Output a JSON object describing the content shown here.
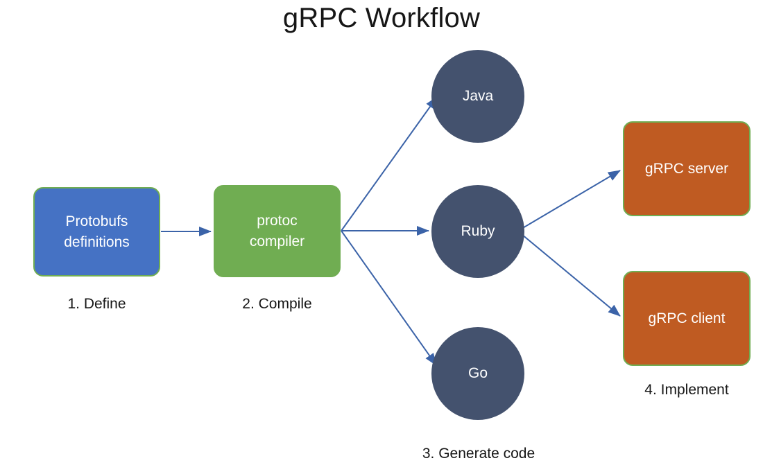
{
  "title": "gRPC Workflow",
  "colors": {
    "blue_box": "#4572C4",
    "green_box": "#70AD52",
    "orange_box": "#BF5B22",
    "circle": "#44526E",
    "arrow": "#3B63A8",
    "border_green": "#70AD52",
    "text_dark": "#161616",
    "node_text": "#ffffff",
    "background": "#ffffff"
  },
  "nodes": {
    "protobufs": {
      "label": "Protobufs\ndefinitions",
      "shape": "rounded-rect",
      "color": "#4572C4"
    },
    "protoc": {
      "label": "protoc\ncompiler",
      "shape": "rounded-rect",
      "color": "#70AD52"
    },
    "java": {
      "label": "Java",
      "shape": "circle",
      "color": "#44526E"
    },
    "ruby": {
      "label": "Ruby",
      "shape": "circle",
      "color": "#44526E"
    },
    "go": {
      "label": "Go",
      "shape": "circle",
      "color": "#44526E"
    },
    "grpc_server": {
      "label": "gRPC server",
      "shape": "rounded-rect",
      "color": "#BF5B22"
    },
    "grpc_client": {
      "label": "gRPC client",
      "shape": "rounded-rect",
      "color": "#BF5B22"
    }
  },
  "steps": [
    {
      "id": "step-1",
      "label": "1. Define"
    },
    {
      "id": "step-2",
      "label": "2. Compile"
    },
    {
      "id": "step-3",
      "label": "3. Generate code"
    },
    {
      "id": "step-4",
      "label": "4. Implement"
    }
  ],
  "edges": [
    {
      "from": "protobufs",
      "to": "protoc"
    },
    {
      "from": "protoc",
      "to": "java"
    },
    {
      "from": "protoc",
      "to": "ruby"
    },
    {
      "from": "protoc",
      "to": "go"
    },
    {
      "from": "ruby",
      "to": "grpc_server"
    },
    {
      "from": "ruby",
      "to": "grpc_client"
    }
  ]
}
